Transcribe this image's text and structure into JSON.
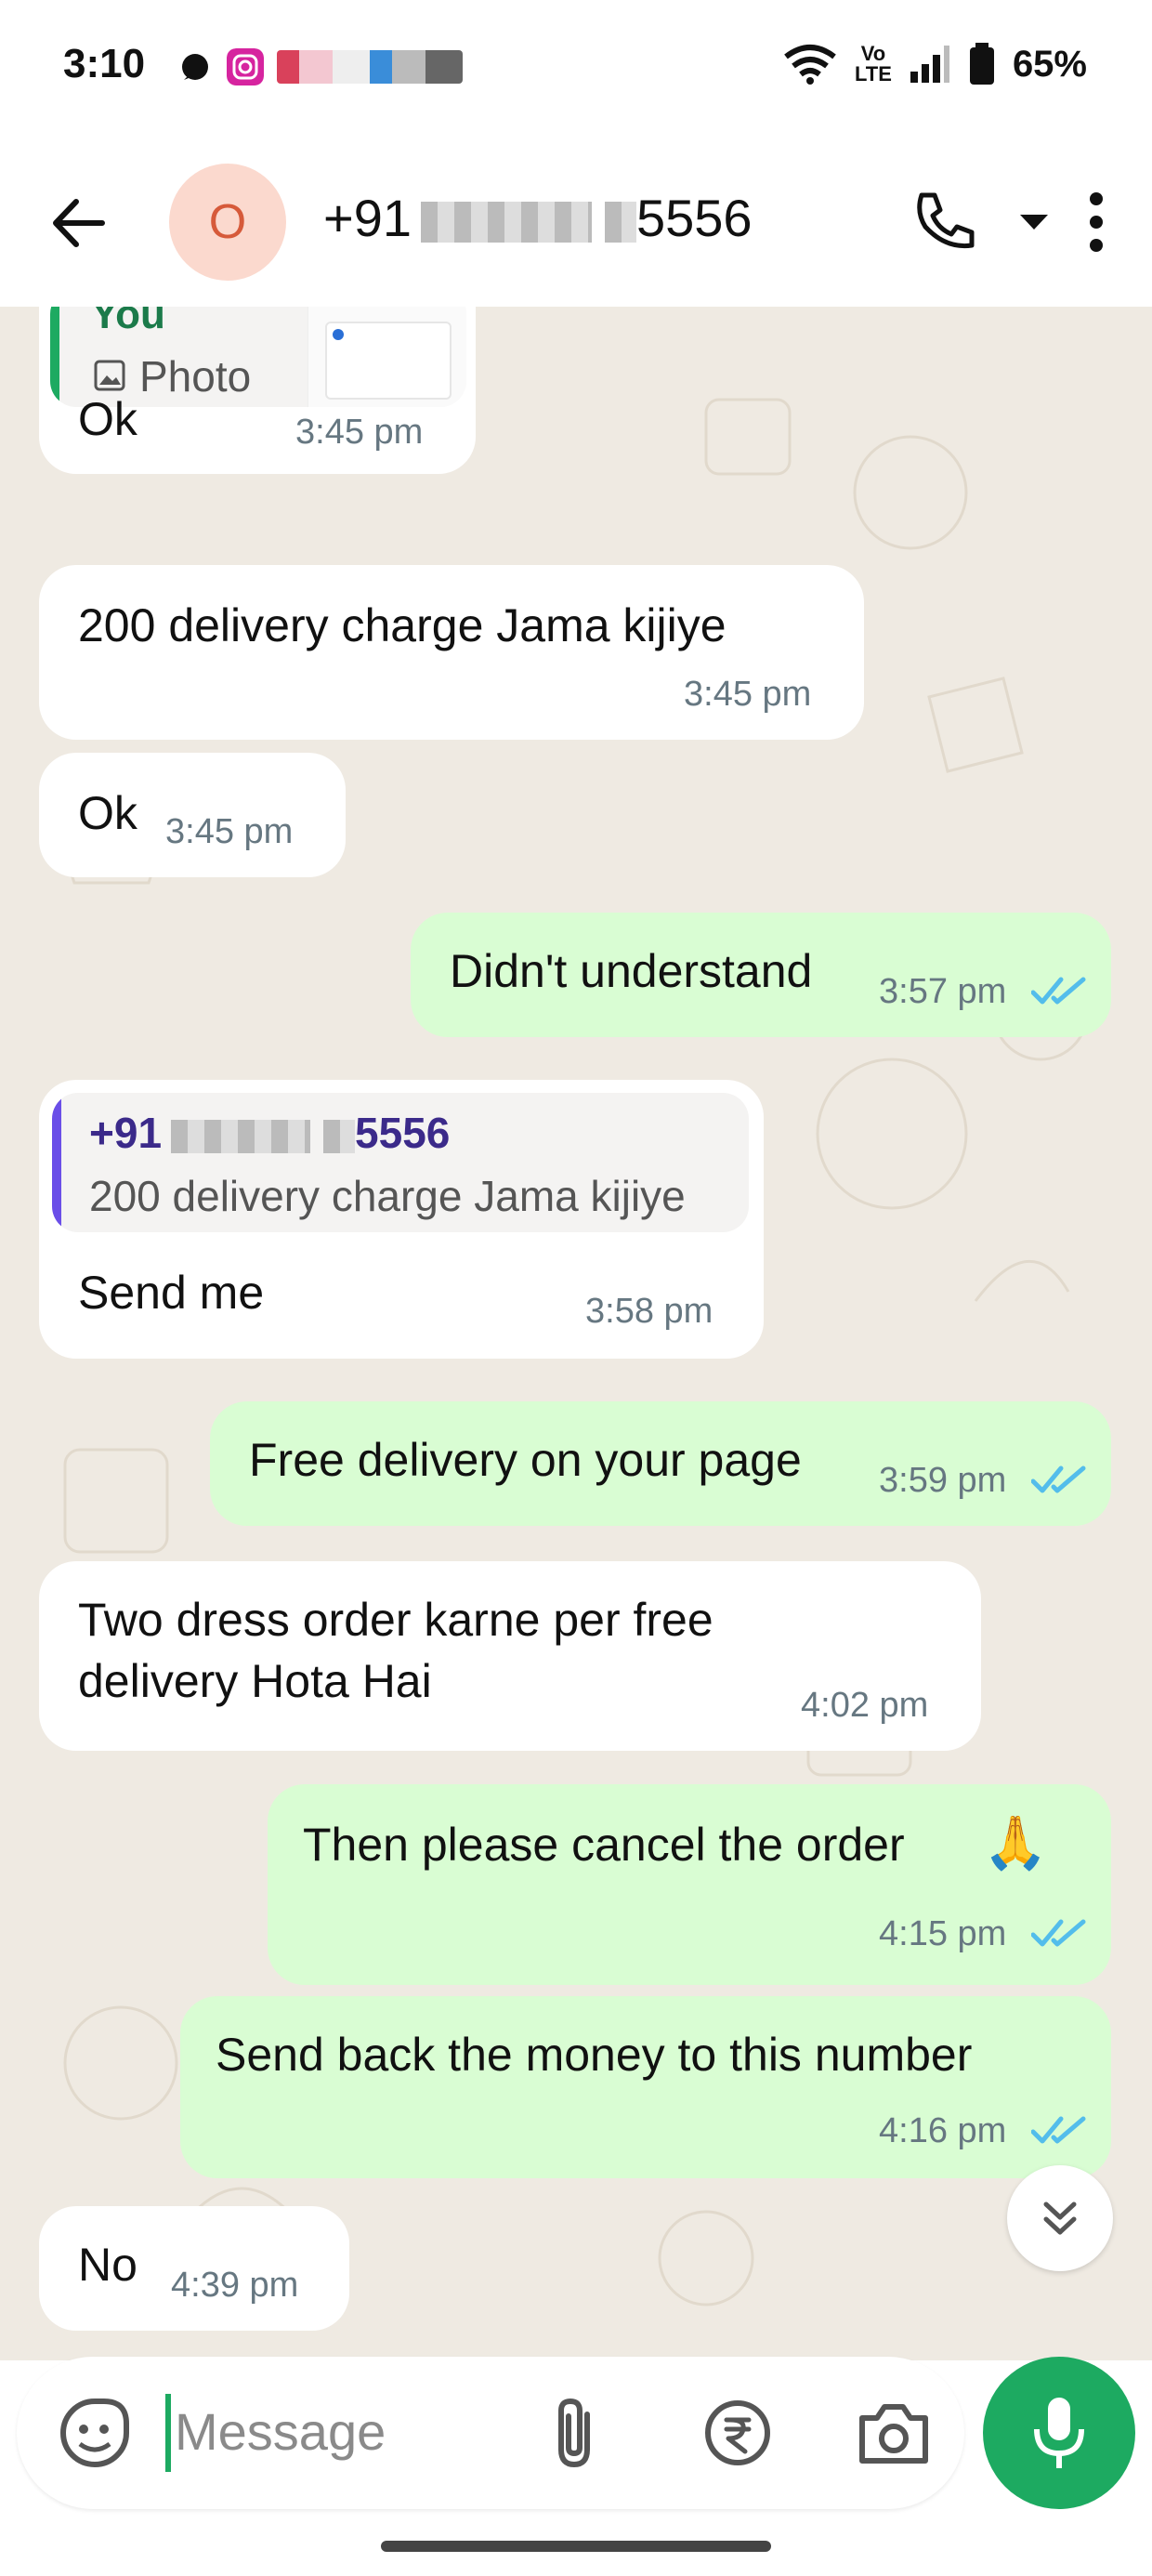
{
  "status_bar": {
    "time": "3:10",
    "battery": "65%",
    "network_label": "Vo LTE"
  },
  "header": {
    "avatar_letter": "O",
    "contact_prefix": "+91",
    "contact_suffix": "5556"
  },
  "messages": {
    "m1": {
      "quote_author": "You",
      "quote_type": "Photo",
      "text": "Ok",
      "time": "3:45 pm"
    },
    "m2": {
      "text": "200 delivery charge Jama kijiye",
      "time": "3:45 pm"
    },
    "m3": {
      "text": "Ok",
      "time": "3:45 pm"
    },
    "m4": {
      "text": "Didn't understand",
      "time": "3:57 pm"
    },
    "m5": {
      "quote_author_prefix": "+91",
      "quote_author_suffix": "5556",
      "quote_text": "200 delivery charge Jama kijiye",
      "text": "Send me",
      "time": "3:58 pm"
    },
    "m6": {
      "text": "Free delivery on your page",
      "time": "3:59 pm"
    },
    "m7": {
      "line1": "Two dress order karne per free",
      "line2": "delivery Hota Hai",
      "time": "4:02 pm"
    },
    "m8": {
      "text": "Then please cancel the order",
      "emoji": "🙏",
      "time": "4:15 pm"
    },
    "m9": {
      "text": "Send back the money to this number",
      "time": "4:16 pm"
    },
    "m10": {
      "text": "No",
      "time": "4:39 pm"
    }
  },
  "composer": {
    "placeholder": "Message"
  },
  "colors": {
    "outgoing": "#d9fdd3",
    "incoming": "#ffffff",
    "accent": "#1daa61",
    "tick": "#53bdeb"
  },
  "icons": [
    "back-arrow-icon",
    "phone-icon",
    "dropdown-icon",
    "more-icon",
    "photo-icon",
    "sticker-icon",
    "attach-icon",
    "rupee-icon",
    "camera-icon",
    "mic-icon",
    "scroll-down-icon",
    "double-tick-icon"
  ]
}
